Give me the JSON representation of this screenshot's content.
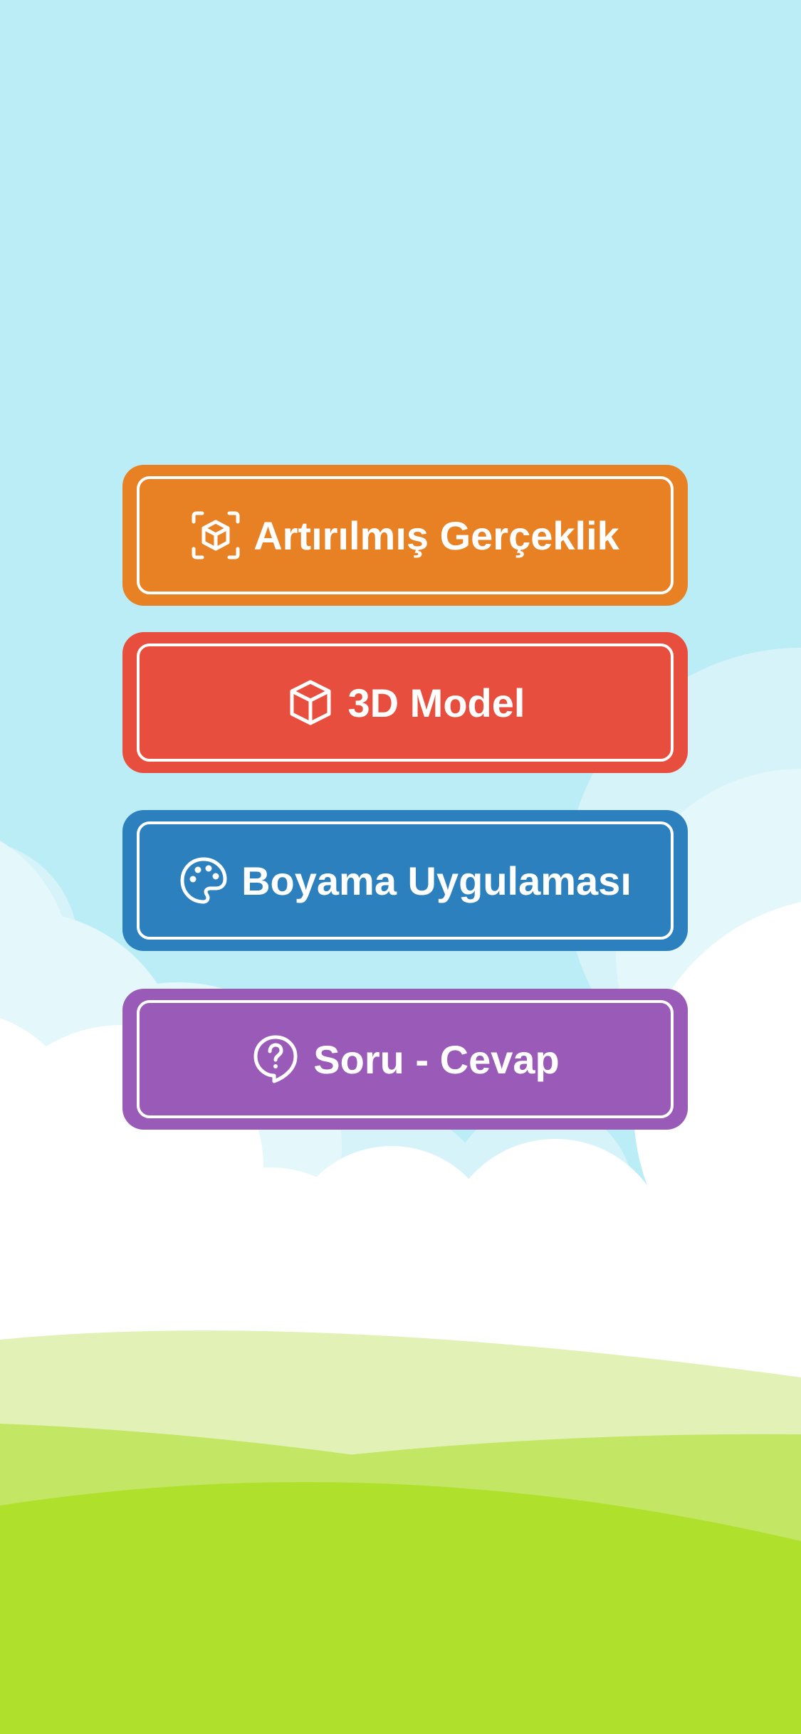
{
  "colors": {
    "sky": "#bbedf7",
    "cloud_back": "#d7f3fa",
    "cloud_mid": "#e4f7fb",
    "cloud_front": "#ffffff",
    "grass_light": "#e2f2b6",
    "grass_mid": "#c4e665",
    "grass_dark": "#afe02c",
    "orange": "#e88123",
    "red": "#e84e3e",
    "blue": "#2b80bd",
    "purple": "#9a5bb8",
    "white": "#ffffff"
  },
  "menu": {
    "items": [
      {
        "label": "Artırılmış Gerçeklik",
        "icon": "ar-cube-scan-icon",
        "color": "#e88123"
      },
      {
        "label": "3D Model",
        "icon": "cube-icon",
        "color": "#e84e3e"
      },
      {
        "label": "Boyama Uygulaması",
        "icon": "palette-icon",
        "color": "#2b80bd"
      },
      {
        "label": "Soru - Cevap",
        "icon": "question-bubble-icon",
        "color": "#9a5bb8"
      }
    ]
  }
}
